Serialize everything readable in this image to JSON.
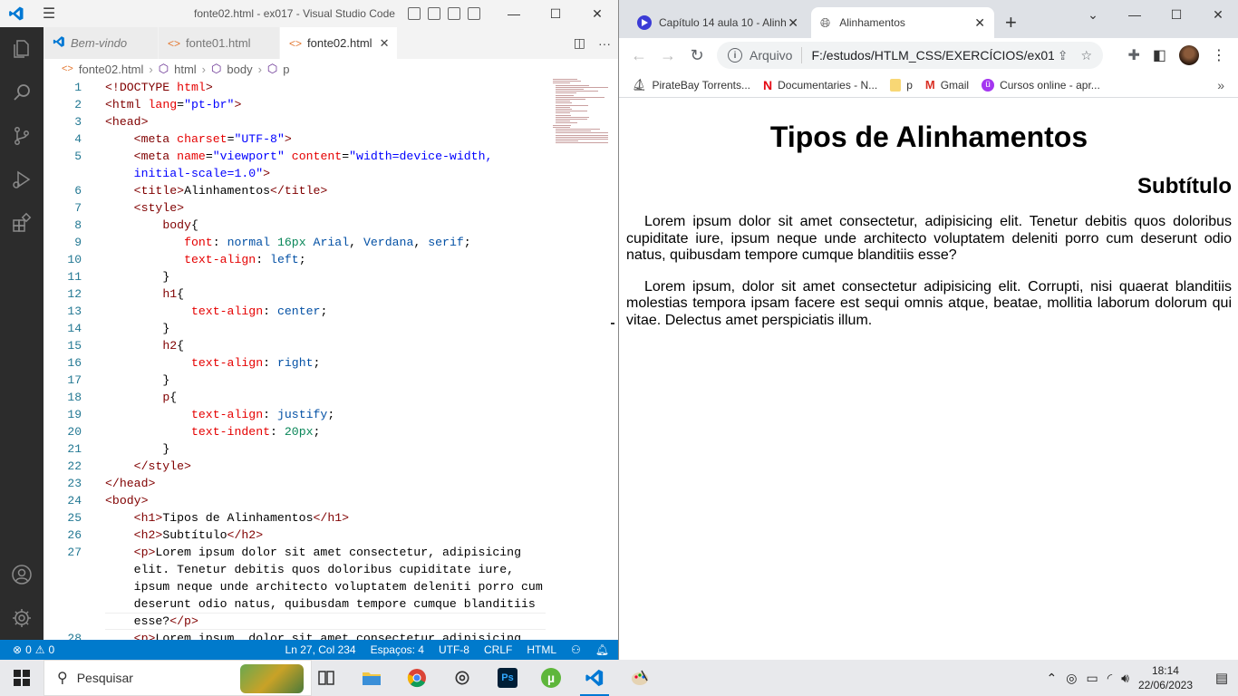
{
  "vscode": {
    "title": "fonte02.html - ex017 - Visual Studio Code",
    "tabs": [
      {
        "label": "Bem-vindo",
        "icon": "vscode-icon"
      },
      {
        "label": "fonte01.html",
        "icon": "html-icon"
      },
      {
        "label": "fonte02.html",
        "icon": "html-icon",
        "active": true
      }
    ],
    "breadcrumb": [
      "fonte02.html",
      "html",
      "body",
      "p"
    ],
    "code_lines": [
      {
        "n": "1",
        "html": "<span class='t-tag'>&lt;!DOCTYPE</span> <span class='t-attr'>html</span><span class='t-tag'>&gt;</span>"
      },
      {
        "n": "2",
        "html": "<span class='t-tag'>&lt;html</span> <span class='t-attr'>lang</span><span class='t-br'>=</span><span class='t-val'>\"pt-br\"</span><span class='t-tag'>&gt;</span>"
      },
      {
        "n": "3",
        "html": "<span class='t-tag'>&lt;head&gt;</span>"
      },
      {
        "n": "4",
        "html": "    <span class='t-tag'>&lt;meta</span> <span class='t-attr'>charset</span><span class='t-br'>=</span><span class='t-val'>\"UTF-8\"</span><span class='t-tag'>&gt;</span>"
      },
      {
        "n": "5",
        "html": "    <span class='t-tag'>&lt;meta</span> <span class='t-attr'>name</span><span class='t-br'>=</span><span class='t-val'>\"viewport\"</span> <span class='t-attr'>content</span><span class='t-br'>=</span><span class='t-val'>\"width=device-width,</span>"
      },
      {
        "n": "",
        "html": "    <span class='t-val'>initial-scale=1.0\"</span><span class='t-tag'>&gt;</span>"
      },
      {
        "n": "6",
        "html": "    <span class='t-tag'>&lt;title&gt;</span><span class='t-txt'>Alinhamentos</span><span class='t-tag'>&lt;/title&gt;</span>"
      },
      {
        "n": "7",
        "html": "    <span class='t-tag'>&lt;style&gt;</span>"
      },
      {
        "n": "8",
        "html": "        <span class='t-sel'>body</span><span class='t-br'>{</span>"
      },
      {
        "n": "9",
        "html": "           <span class='t-prop'>font</span><span class='t-br'>:</span> <span class='t-cval'>normal</span> <span class='t-num'>16px</span> <span class='t-cval'>Arial</span><span class='t-br'>,</span> <span class='t-cval'>Verdana</span><span class='t-br'>,</span> <span class='t-cval'>serif</span><span class='t-br'>;</span>"
      },
      {
        "n": "10",
        "html": "           <span class='t-prop'>text-align</span><span class='t-br'>:</span> <span class='t-cval'>left</span><span class='t-br'>;</span>"
      },
      {
        "n": "11",
        "html": "        <span class='t-br'>}</span>"
      },
      {
        "n": "12",
        "html": "        <span class='t-sel'>h1</span><span class='t-br'>{</span>"
      },
      {
        "n": "13",
        "html": "            <span class='t-prop'>text-align</span><span class='t-br'>:</span> <span class='t-cval'>center</span><span class='t-br'>;</span>"
      },
      {
        "n": "14",
        "html": "        <span class='t-br'>}</span>"
      },
      {
        "n": "15",
        "html": "        <span class='t-sel'>h2</span><span class='t-br'>{</span>"
      },
      {
        "n": "16",
        "html": "            <span class='t-prop'>text-align</span><span class='t-br'>:</span> <span class='t-cval'>right</span><span class='t-br'>;</span>"
      },
      {
        "n": "17",
        "html": "        <span class='t-br'>}</span>"
      },
      {
        "n": "18",
        "html": "        <span class='t-sel'>p</span><span class='t-br'>{</span>"
      },
      {
        "n": "19",
        "html": "            <span class='t-prop'>text-align</span><span class='t-br'>:</span> <span class='t-cval'>justify</span><span class='t-br'>;</span>"
      },
      {
        "n": "20",
        "html": "            <span class='t-prop'>text-indent</span><span class='t-br'>:</span> <span class='t-num'>20px</span><span class='t-br'>;</span>"
      },
      {
        "n": "21",
        "html": "        <span class='t-br'>}</span>"
      },
      {
        "n": "22",
        "html": "    <span class='t-tag'>&lt;/style&gt;</span>"
      },
      {
        "n": "23",
        "html": "<span class='t-tag'>&lt;/head&gt;</span>"
      },
      {
        "n": "24",
        "html": "<span class='t-tag'>&lt;body&gt;</span>"
      },
      {
        "n": "25",
        "html": "    <span class='t-tag'>&lt;h1&gt;</span><span class='t-txt'>Tipos de Alinhamentos</span><span class='t-tag'>&lt;/h1&gt;</span>"
      },
      {
        "n": "26",
        "html": "    <span class='t-tag'>&lt;h2&gt;</span><span class='t-txt'>Subtítulo</span><span class='t-tag'>&lt;/h2&gt;</span>"
      },
      {
        "n": "27",
        "html": "    <span class='t-tag'>&lt;p&gt;</span><span class='t-txt'>Lorem ipsum dolor sit amet consectetur, adipisicing</span>"
      },
      {
        "n": "",
        "html": "    <span class='t-txt'>elit. Tenetur debitis quos doloribus cupiditate iure,</span>"
      },
      {
        "n": "",
        "html": "    <span class='t-txt'>ipsum neque unde architecto voluptatem deleniti porro cum</span>"
      },
      {
        "n": "",
        "html": "    <span class='t-txt'>deserunt odio natus, quibusdam tempore cumque blanditiis</span>"
      },
      {
        "n": "",
        "html": "    <span class='t-txt'>esse?</span><span class='t-tag'>&lt;/p&gt;</span>"
      },
      {
        "n": "28",
        "html": "    <span class='t-tag'>&lt;p&gt;</span><span class='t-txt'>Lorem ipsum, dolor sit amet consectetur adipisicing</span>"
      }
    ],
    "status": {
      "errors": "0",
      "warnings": "0",
      "position": "Ln 27, Col 234",
      "spaces": "Espaços: 4",
      "encoding": "UTF-8",
      "eol": "CRLF",
      "language": "HTML"
    }
  },
  "chrome": {
    "tabs": [
      {
        "label": "Capítulo 14 aula 10 - Alinh",
        "icon": "youtube-icon"
      },
      {
        "label": "Alinhamentos",
        "icon": "globe-icon",
        "active": true
      }
    ],
    "omnibox": {
      "scheme": "Arquivo",
      "url": "F:/estudos/HTLM_CSS/EXERCÍCIOS/ex017..."
    },
    "bookmarks": [
      {
        "label": "PirateBay Torrents...",
        "icon": "pirate-icon"
      },
      {
        "label": "Documentaries - N...",
        "icon": "netflix-icon"
      },
      {
        "label": "p",
        "icon": "folder-icon"
      },
      {
        "label": "Gmail",
        "icon": "gmail-icon"
      },
      {
        "label": "Cursos online - apr...",
        "icon": "udemy-icon"
      }
    ],
    "page": {
      "h1": "Tipos de Alinhamentos",
      "h2": "Subtítulo",
      "p1": "Lorem ipsum dolor sit amet consectetur, adipisicing elit. Tenetur debitis quos doloribus cupiditate iure, ipsum neque unde architecto voluptatem deleniti porro cum deserunt odio natus, quibusdam tempore cumque blanditiis esse?",
      "p2": "Lorem ipsum, dolor sit amet consectetur adipisicing elit. Corrupti, nisi quaerat blanditiis molestias tempora ipsam facere est sequi omnis atque, beatae, mollitia laborum dolorum qui vitae. Delectus amet perspiciatis illum."
    }
  },
  "taskbar": {
    "search_placeholder": "Pesquisar",
    "time": "18:14",
    "date": "22/06/2023"
  },
  "colors": {
    "vscode_accent": "#007acc",
    "chrome_tabbar": "#dee1e6",
    "taskbar": "#e8e9ec"
  }
}
